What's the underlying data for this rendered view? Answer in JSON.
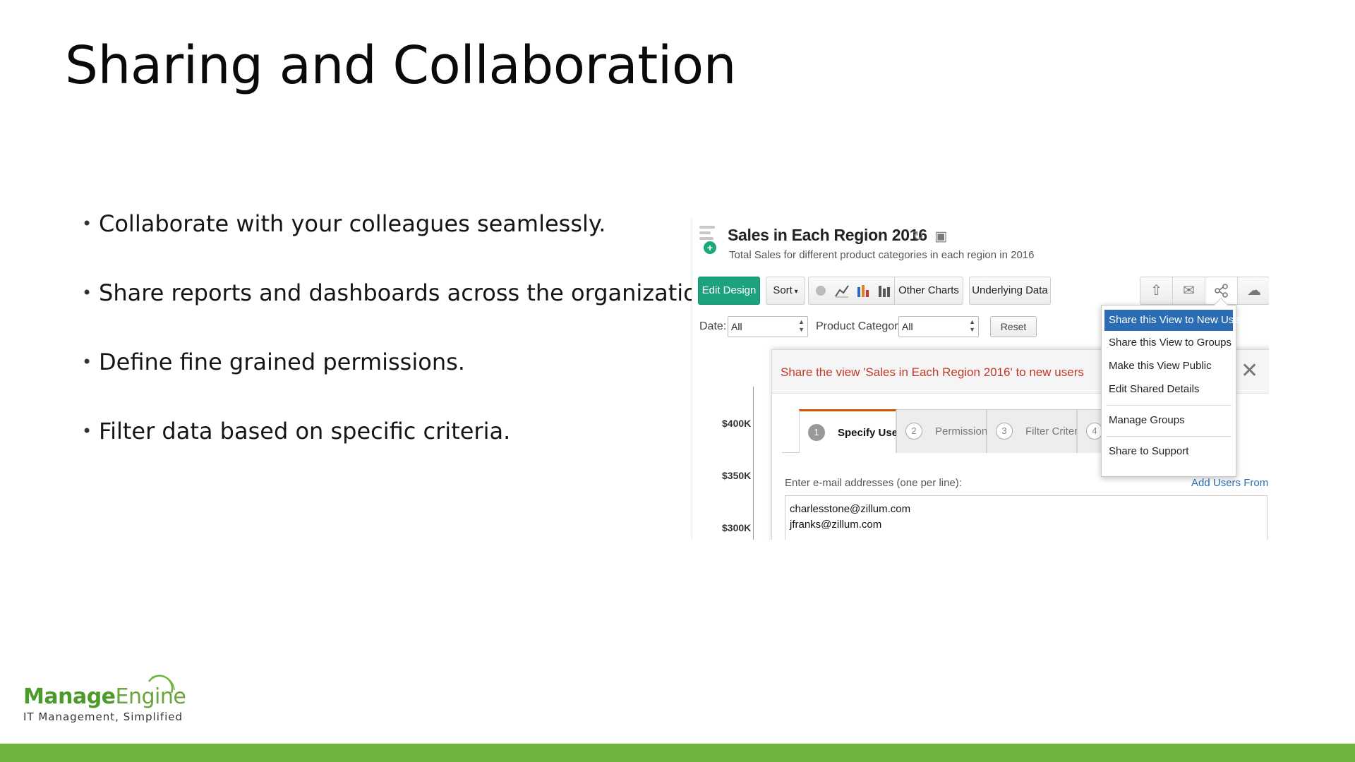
{
  "slide": {
    "title": "Sharing and Collaboration",
    "bullets": [
      "Collaborate with your colleagues seamlessly.",
      "Share reports and dashboards across the organization.",
      "Define fine grained permissions.",
      "Filter data based on specific criteria."
    ]
  },
  "app": {
    "view_title": "Sales in Each Region 2016",
    "view_subtitle": "Total Sales for different product categories in each region in 2016",
    "toolbar": {
      "edit_design": "Edit Design",
      "sort": "Sort",
      "other_charts": "Other Charts",
      "underlying_data": "Underlying Data"
    },
    "filters": {
      "date_label": "Date:",
      "date_value": "All",
      "category_label": "Product Category:",
      "category_value": "All",
      "reset": "Reset"
    },
    "y_ticks": [
      "$400K",
      "$350K",
      "$300K"
    ],
    "dialog": {
      "title": "Share the view 'Sales in Each Region 2016' to new users",
      "tabs": [
        {
          "num": "1",
          "label": "Specify Users"
        },
        {
          "num": "2",
          "label": "Permissions"
        },
        {
          "num": "3",
          "label": "Filter Criteria"
        },
        {
          "num": "4",
          "label": ""
        }
      ],
      "email_label": "Enter e-mail addresses (one per line):",
      "add_users_from": "Add Users From",
      "emails": [
        "charlesstone@zillum.com",
        "jfranks@zillum.com"
      ]
    },
    "share_menu": [
      "Share this View to New Users",
      "Share this View to Groups",
      "Make this View Public",
      "Edit Shared Details",
      "Manage Groups",
      "Share to Support"
    ]
  },
  "brand": {
    "name_part1": "Manage",
    "name_part2": "Engine",
    "tagline": "IT Management, Simplified"
  },
  "colors": {
    "accent_green": "#6cb33f",
    "edit_design_bg": "#1ca27f",
    "menu_highlight": "#2a6db5",
    "dialog_title": "#c0392b"
  }
}
